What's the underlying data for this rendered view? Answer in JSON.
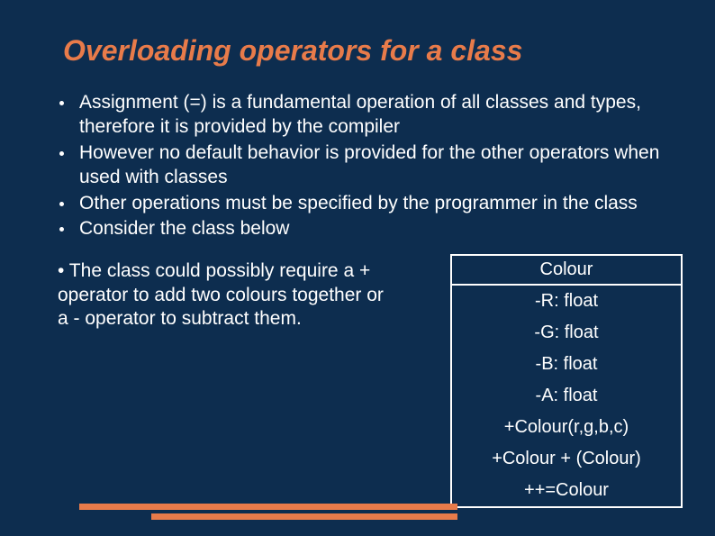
{
  "title": "Overloading operators for a class",
  "bullets": [
    "Assignment (=) is a fundamental operation of all classes and types, therefore it is provided by the compiler",
    "However no default behavior is provided for the other operators when used with classes",
    "Other operations must be specified by the programmer in the class",
    "Consider the class below"
  ],
  "paragraph": "• The class could possibly require a + operator to add two colours together or a - operator to subtract them.",
  "classBox": {
    "name": "Colour",
    "rows": [
      "-R: float",
      "-G: float",
      "-B: float",
      "-A: float",
      "+Colour(r,g,b,c)",
      "+Colour + (Colour)",
      "++=Colour"
    ]
  }
}
